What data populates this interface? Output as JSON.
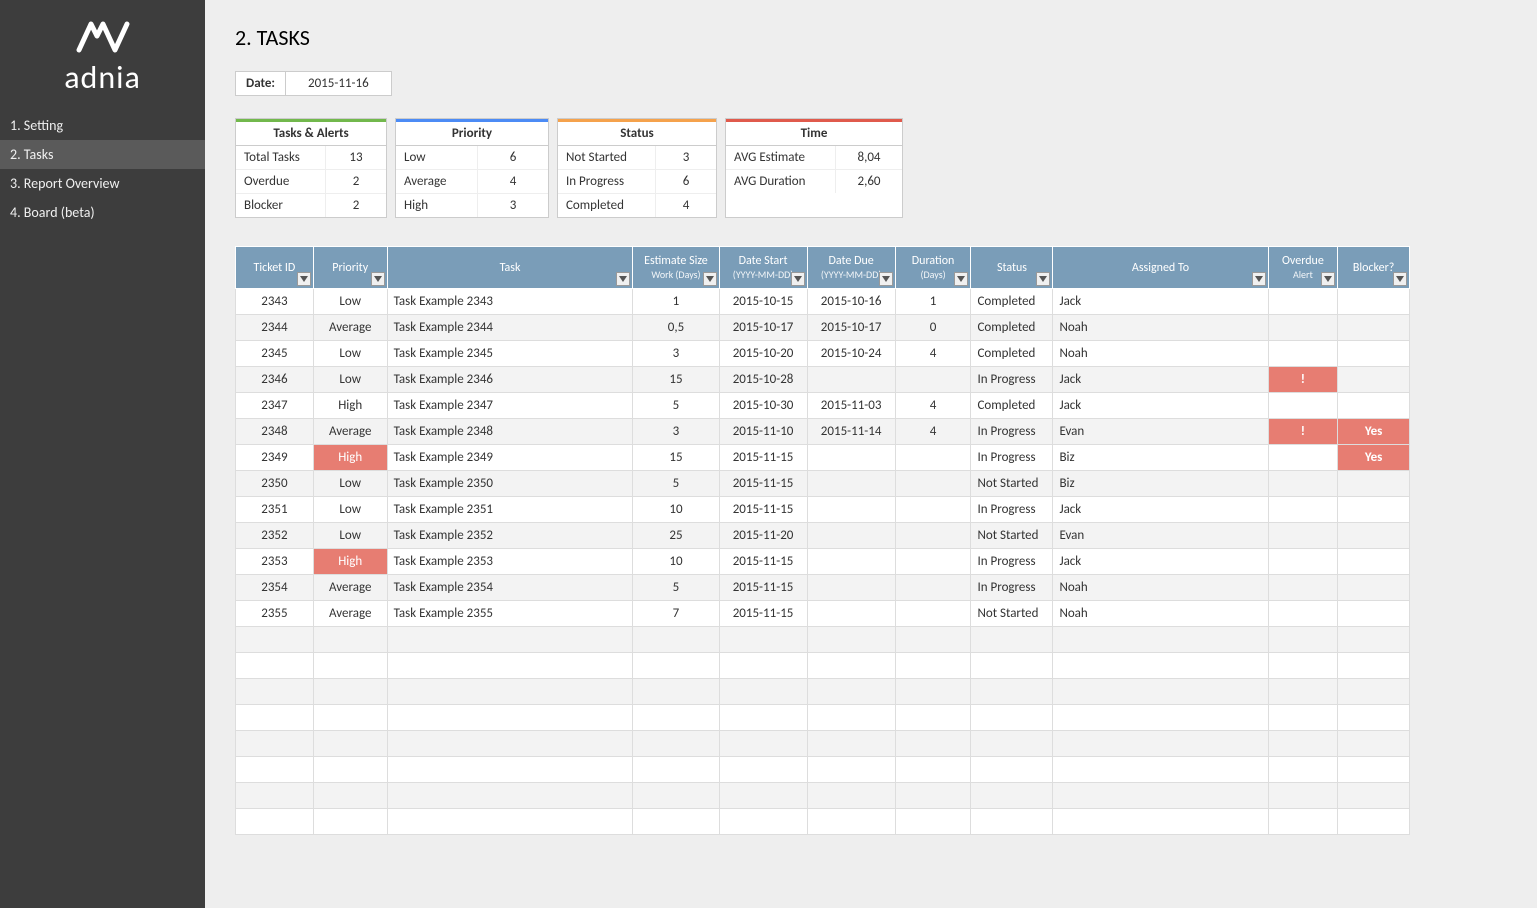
{
  "brand": {
    "name": "adnia"
  },
  "nav": {
    "items": [
      {
        "label": "1. Setting"
      },
      {
        "label": "2. Tasks"
      },
      {
        "label": "3. Report Overview"
      },
      {
        "label": "4. Board (beta)"
      }
    ],
    "active_index": 1
  },
  "page": {
    "title": "2. TASKS",
    "date_label": "Date:",
    "date_value": "2015-11-16"
  },
  "summary": {
    "tasks_alerts": {
      "header": "Tasks & Alerts",
      "rows": [
        {
          "k": "Total Tasks",
          "v": "13"
        },
        {
          "k": "Overdue",
          "v": "2"
        },
        {
          "k": "Blocker",
          "v": "2"
        }
      ]
    },
    "priority": {
      "header": "Priority",
      "rows": [
        {
          "k": "Low",
          "v": "6"
        },
        {
          "k": "Average",
          "v": "4"
        },
        {
          "k": "High",
          "v": "3"
        }
      ]
    },
    "status": {
      "header": "Status",
      "rows": [
        {
          "k": "Not Started",
          "v": "3"
        },
        {
          "k": "In Progress",
          "v": "6"
        },
        {
          "k": "Completed",
          "v": "4"
        }
      ]
    },
    "time": {
      "header": "Time",
      "rows": [
        {
          "k": "AVG Estimate",
          "v": "8,04"
        },
        {
          "k": "AVG Duration",
          "v": "2,60"
        }
      ]
    }
  },
  "table": {
    "columns": [
      {
        "label": "Ticket ID",
        "sub": ""
      },
      {
        "label": "Priority",
        "sub": ""
      },
      {
        "label": "Task",
        "sub": ""
      },
      {
        "label": "Estimate Size",
        "sub": "Work (Days)"
      },
      {
        "label": "Date Start",
        "sub": "(YYYY-MM-DD)"
      },
      {
        "label": "Date Due",
        "sub": "(YYYY-MM-DD)"
      },
      {
        "label": "Duration",
        "sub": "(Days)"
      },
      {
        "label": "Status",
        "sub": ""
      },
      {
        "label": "Assigned To",
        "sub": ""
      },
      {
        "label": "Overdue",
        "sub": "Alert"
      },
      {
        "label": "Blocker?",
        "sub": ""
      }
    ],
    "rows": [
      {
        "id": "2343",
        "priority": "Low",
        "task": "Task Example 2343",
        "estimate": "1",
        "start": "2015-10-15",
        "due": "2015-10-16",
        "duration": "1",
        "status": "Completed",
        "assigned": "Jack",
        "overdue": "",
        "blocker": ""
      },
      {
        "id": "2344",
        "priority": "Average",
        "task": "Task Example 2344",
        "estimate": "0,5",
        "start": "2015-10-17",
        "due": "2015-10-17",
        "duration": "0",
        "status": "Completed",
        "assigned": "Noah",
        "overdue": "",
        "blocker": ""
      },
      {
        "id": "2345",
        "priority": "Low",
        "task": "Task Example 2345",
        "estimate": "3",
        "start": "2015-10-20",
        "due": "2015-10-24",
        "duration": "4",
        "status": "Completed",
        "assigned": "Noah",
        "overdue": "",
        "blocker": ""
      },
      {
        "id": "2346",
        "priority": "Low",
        "task": "Task Example 2346",
        "estimate": "15",
        "start": "2015-10-28",
        "due": "",
        "duration": "",
        "status": "In Progress",
        "assigned": "Jack",
        "overdue": "!",
        "blocker": ""
      },
      {
        "id": "2347",
        "priority": "High",
        "task": "Task Example 2347",
        "estimate": "5",
        "start": "2015-10-30",
        "due": "2015-11-03",
        "duration": "4",
        "status": "Completed",
        "assigned": "Jack",
        "overdue": "",
        "blocker": ""
      },
      {
        "id": "2348",
        "priority": "Average",
        "task": "Task Example 2348",
        "estimate": "3",
        "start": "2015-11-10",
        "due": "2015-11-14",
        "duration": "4",
        "status": "In Progress",
        "assigned": "Evan",
        "overdue": "!",
        "blocker": "Yes"
      },
      {
        "id": "2349",
        "priority": "High",
        "pri_highlight": true,
        "task": "Task Example 2349",
        "estimate": "15",
        "start": "2015-11-15",
        "due": "",
        "duration": "",
        "status": "In Progress",
        "assigned": "Biz",
        "overdue": "",
        "blocker": "Yes"
      },
      {
        "id": "2350",
        "priority": "Low",
        "task": "Task Example 2350",
        "estimate": "5",
        "start": "2015-11-15",
        "due": "",
        "duration": "",
        "status": "Not Started",
        "assigned": "Biz",
        "overdue": "",
        "blocker": ""
      },
      {
        "id": "2351",
        "priority": "Low",
        "task": "Task Example 2351",
        "estimate": "10",
        "start": "2015-11-15",
        "due": "",
        "duration": "",
        "status": "In Progress",
        "assigned": "Jack",
        "overdue": "",
        "blocker": ""
      },
      {
        "id": "2352",
        "priority": "Low",
        "task": "Task Example 2352",
        "estimate": "25",
        "start": "2015-11-20",
        "due": "",
        "duration": "",
        "status": "Not Started",
        "assigned": "Evan",
        "overdue": "",
        "blocker": ""
      },
      {
        "id": "2353",
        "priority": "High",
        "pri_highlight": true,
        "task": "Task Example 2353",
        "estimate": "10",
        "start": "2015-11-15",
        "due": "",
        "duration": "",
        "status": "In Progress",
        "assigned": "Jack",
        "overdue": "",
        "blocker": ""
      },
      {
        "id": "2354",
        "priority": "Average",
        "task": "Task Example 2354",
        "estimate": "5",
        "start": "2015-11-15",
        "due": "",
        "duration": "",
        "status": "In Progress",
        "assigned": "Noah",
        "overdue": "",
        "blocker": ""
      },
      {
        "id": "2355",
        "priority": "Average",
        "task": "Task Example 2355",
        "estimate": "7",
        "start": "2015-11-15",
        "due": "",
        "duration": "",
        "status": "Not Started",
        "assigned": "Noah",
        "overdue": "",
        "blocker": ""
      }
    ],
    "empty_rows": 8
  }
}
